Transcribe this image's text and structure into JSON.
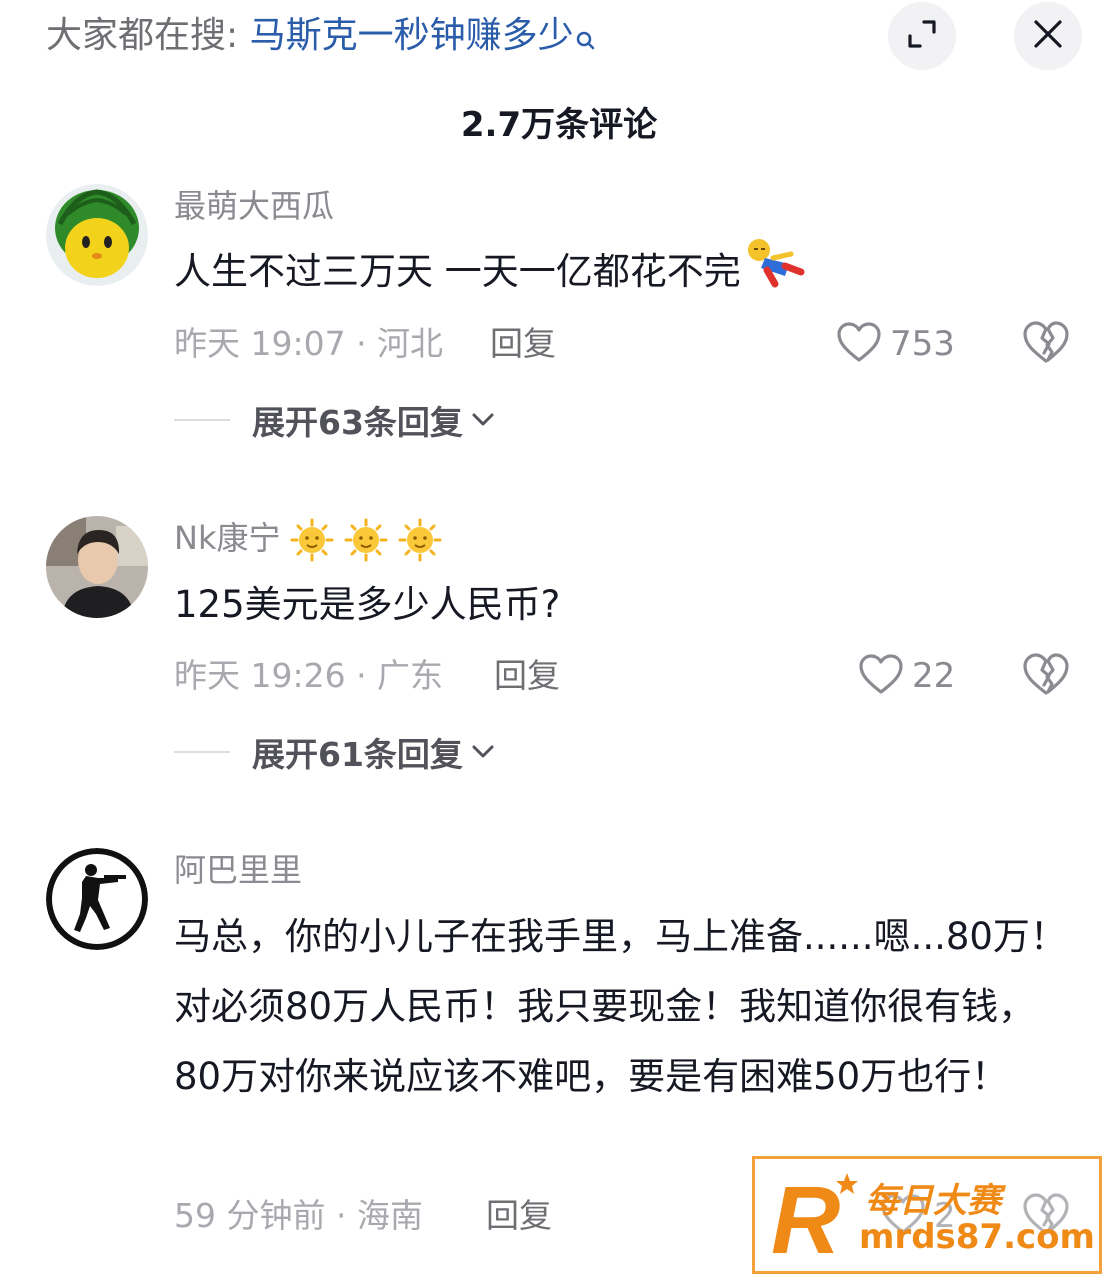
{
  "header": {
    "search_prefix": "大家都在搜: ",
    "search_query": "马斯克一秒钟赚多少",
    "comment_count": "2.7万条评论"
  },
  "comments": [
    {
      "username": "最萌大西瓜",
      "content": "人生不过三万天 一天一亿都花不完",
      "meta": "昨天 19:07 · 河北",
      "reply_label": "回复",
      "likes": "753",
      "expand_label": "展开63条回复",
      "avatar_icon": "watermelon-avatar",
      "content_emoji": "lying-down-emoji"
    },
    {
      "username": "Nk康宁",
      "username_emojis": [
        "sun-face-emoji",
        "sun-face-emoji",
        "sun-face-emoji"
      ],
      "content": "125美元是多少人民币?",
      "meta": "昨天 19:26 · 广东",
      "reply_label": "回复",
      "likes": "22",
      "expand_label": "展开61条回复",
      "avatar_icon": "person-photo-avatar"
    },
    {
      "username": "阿巴里里",
      "content": "马总，你的小儿子在我手里，马上准备......嗯...80万！对必须80万人民币！我只要现金！我知道你很有钱，80万对你来说应该不难吧，要是有困难50万也行！",
      "meta": "59 分钟前 · 海南",
      "reply_label": "回复",
      "likes": "2",
      "avatar_icon": "soldier-silhouette-avatar"
    }
  ],
  "watermark": {
    "line1": "每日大赛",
    "line2": "mrds87.com",
    "logo_letter": "R"
  },
  "colors": {
    "query_blue": "#2a5caa",
    "meta_gray": "#a8a9ae",
    "watermark_orange": "#f08a17"
  }
}
